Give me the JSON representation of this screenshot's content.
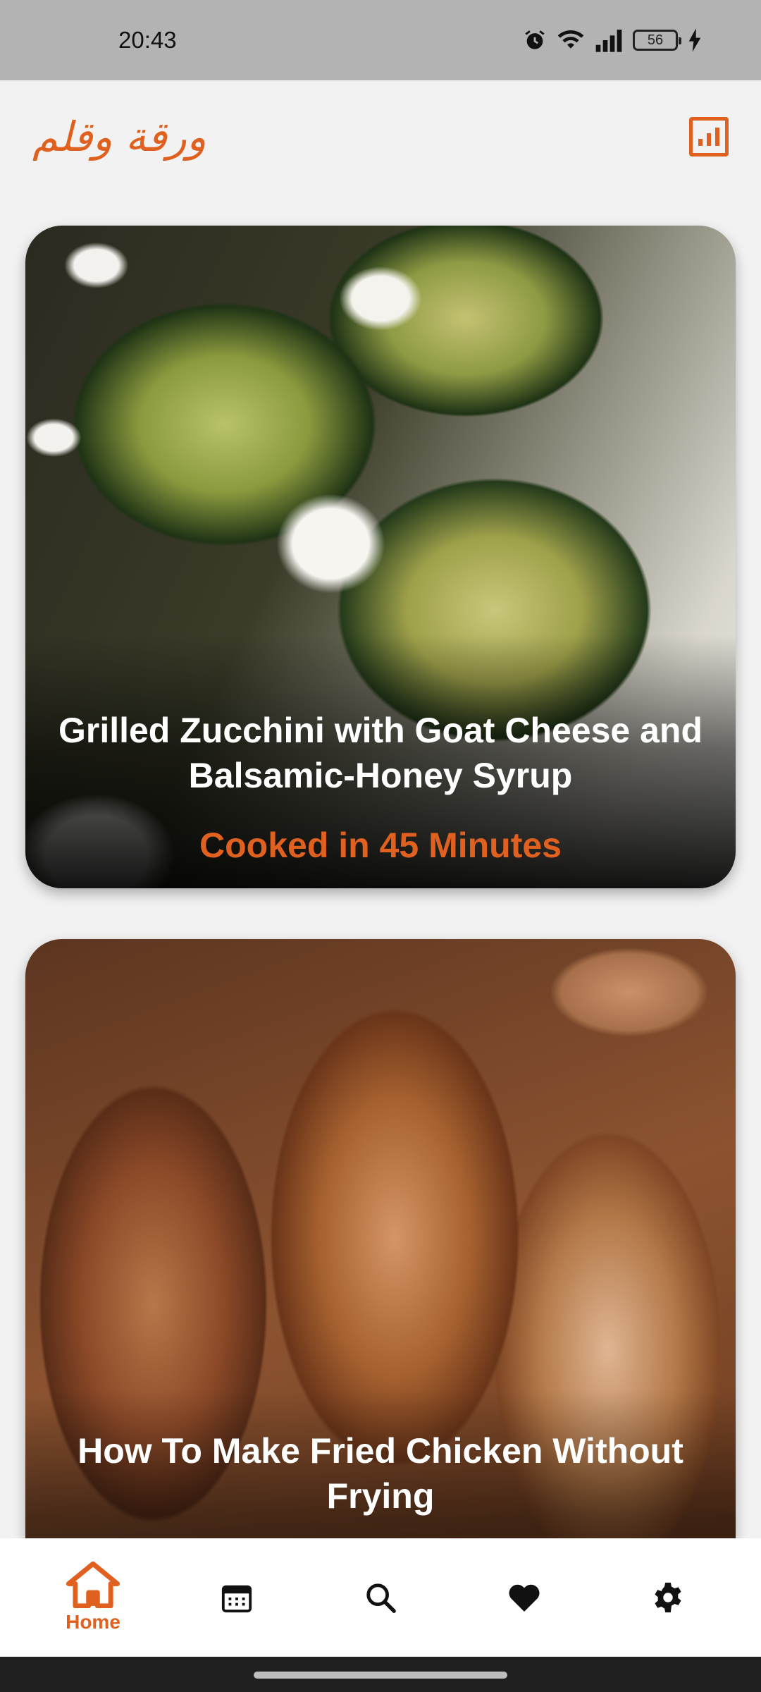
{
  "status_bar": {
    "time": "20:43",
    "battery": "56",
    "icons": [
      "alarm-icon",
      "wifi-icon",
      "signal-icon",
      "battery-icon",
      "charging-icon"
    ]
  },
  "header": {
    "logo_text": "ورقة وقلم",
    "stats_icon": "bar-chart-icon",
    "accent_color": "#e0601f"
  },
  "recipes": [
    {
      "title": "Grilled Zucchini with Goat Cheese and Balsamic-Honey Syrup",
      "cook_time": "Cooked in 45 Minutes"
    },
    {
      "title": "How To Make Fried Chicken Without Frying"
    }
  ],
  "bottom_nav": {
    "items": [
      {
        "label": "Home",
        "icon": "home-icon",
        "active": true
      },
      {
        "icon": "calendar-icon"
      },
      {
        "icon": "search-icon"
      },
      {
        "icon": "heart-icon"
      },
      {
        "icon": "gear-icon"
      }
    ]
  }
}
